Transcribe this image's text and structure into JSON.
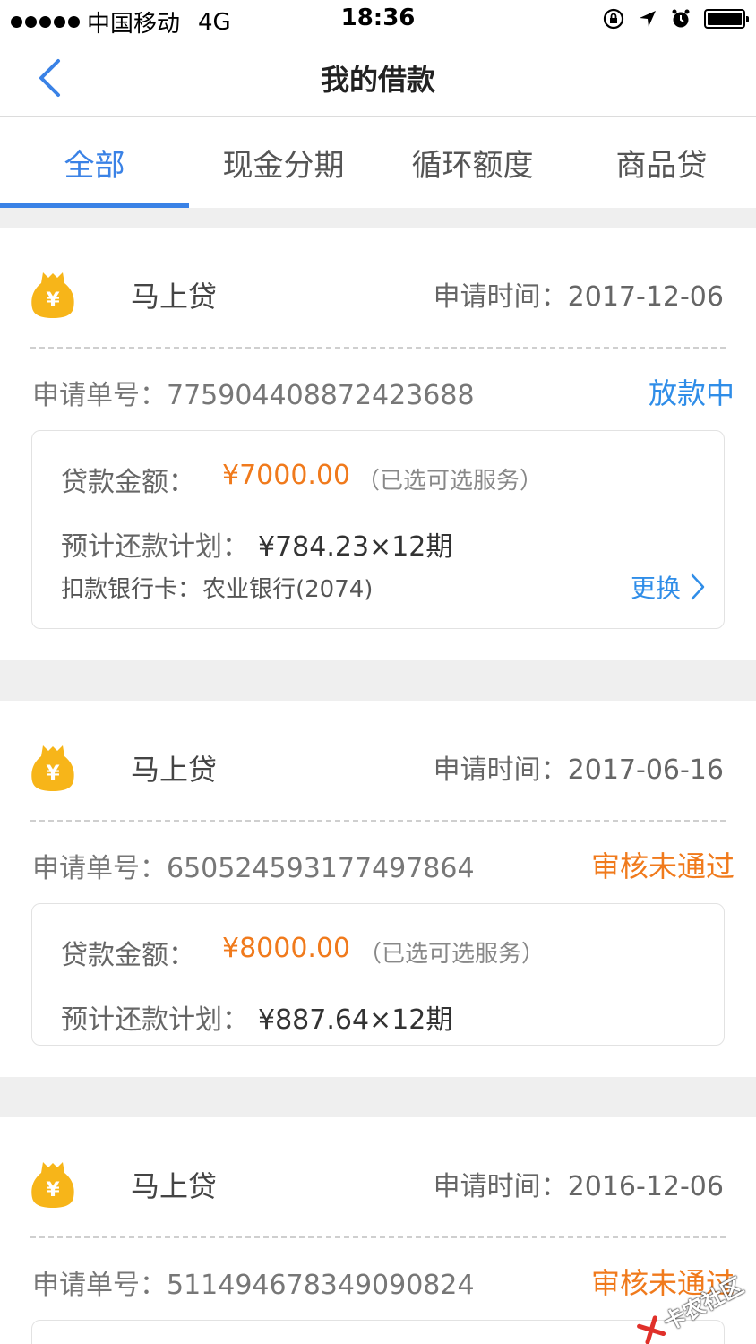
{
  "status_bar": {
    "carrier": "中国移动",
    "network": "4G",
    "time": "18:36"
  },
  "nav": {
    "title": "我的借款"
  },
  "tabs": [
    {
      "label": "全部",
      "active": true
    },
    {
      "label": "现金分期",
      "active": false
    },
    {
      "label": "循环额度",
      "active": false
    },
    {
      "label": "商品贷",
      "active": false
    }
  ],
  "loans": [
    {
      "product": "马上贷",
      "apply_time": "申请时间：2017-12-06",
      "order_no": "申请单号：775904408872423688",
      "status": "放款中",
      "status_color": "#2f8de8",
      "amount_label": "贷款金额：",
      "amount": "¥7000.00",
      "service": "（已选可选服务）",
      "plan_label": "预计还款计划：",
      "plan": "¥784.23×12期",
      "bank_label": "扣款银行卡：",
      "bank": "农业银行(2074)",
      "change_label": "更换"
    },
    {
      "product": "马上贷",
      "apply_time": "申请时间：2017-06-16",
      "order_no": "申请单号：650524593177497864",
      "status": "审核未通过",
      "status_color": "#f07a1c",
      "amount_label": "贷款金额：",
      "amount": "¥8000.00",
      "service": "（已选可选服务）",
      "plan_label": "预计还款计划：",
      "plan": "¥887.64×12期"
    },
    {
      "product": "马上贷",
      "apply_time": "申请时间：2016-12-06",
      "order_no": "申请单号：511494678349090824",
      "status": "审核未通过",
      "status_color": "#f07a1c"
    }
  ],
  "watermark": {
    "text": "卡农社区"
  },
  "colors": {
    "accent": "#3a82e6",
    "amount": "#f07a1c",
    "icon_yellow": "#f7b519"
  }
}
